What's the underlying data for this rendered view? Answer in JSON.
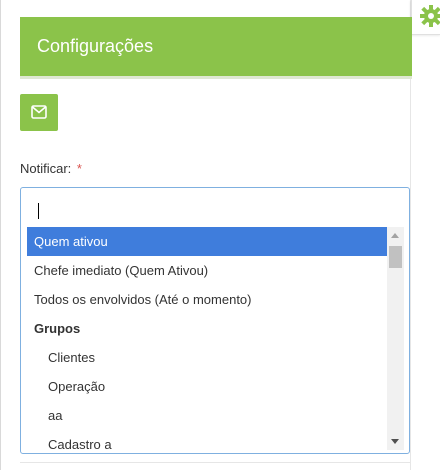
{
  "header": {
    "title": "Configurações"
  },
  "email_button": {
    "icon": "envelope-icon"
  },
  "settings_tab": {
    "icon": "gear-icon"
  },
  "notify": {
    "label": "Notificar:",
    "required_mark": "*"
  },
  "select": {
    "search_value": "",
    "options": [
      {
        "label": "Quem ativou",
        "type": "option",
        "highlighted": true
      },
      {
        "label": "Chefe imediato (Quem Ativou)",
        "type": "option",
        "highlighted": false
      },
      {
        "label": "Todos os envolvidos (Até o momento)",
        "type": "option",
        "highlighted": false
      },
      {
        "label": "Grupos",
        "type": "group",
        "highlighted": false
      },
      {
        "label": "Clientes",
        "type": "child",
        "highlighted": false
      },
      {
        "label": "Operação",
        "type": "child",
        "highlighted": false
      },
      {
        "label": "aa",
        "type": "child",
        "highlighted": false
      },
      {
        "label": "Cadastro a",
        "type": "child",
        "highlighted": false
      }
    ]
  },
  "colors": {
    "accent_green": "#8bc34a",
    "highlight_blue": "#3f7ddc",
    "required_red": "#d9534f"
  }
}
